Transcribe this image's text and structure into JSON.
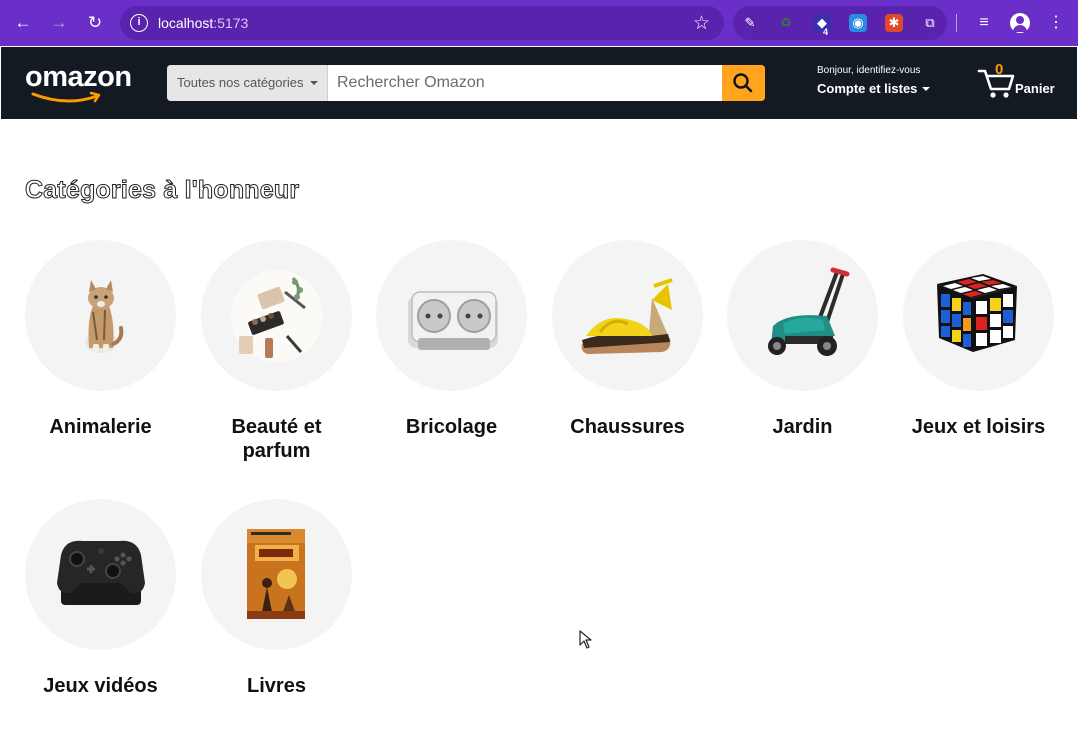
{
  "browser": {
    "url_host": "localhost",
    "url_port": ":5173",
    "extension_badge": "4"
  },
  "header": {
    "logo": "omazon",
    "search_category": "Toutes nos catégories",
    "search_placeholder": "Rechercher Omazon",
    "account_greeting": "Bonjour, identifiez-vous",
    "account_lists": "Compte et listes",
    "cart_count": "0",
    "cart_label": "Panier"
  },
  "main": {
    "section_title": "Catégories à l'honneur",
    "categories": [
      {
        "label": "Animalerie",
        "icon": "cat-photo-icon"
      },
      {
        "label": "Beauté et parfum",
        "icon": "cosmetics-photo-icon"
      },
      {
        "label": "Bricolage",
        "icon": "power-outlet-photo-icon"
      },
      {
        "label": "Chaussures",
        "icon": "sandal-photo-icon"
      },
      {
        "label": "Jardin",
        "icon": "lawn-mower-photo-icon"
      },
      {
        "label": "Jeux et loisirs",
        "icon": "rubiks-cube-photo-icon"
      },
      {
        "label": "Jeux vidéos",
        "icon": "gamepad-photo-icon"
      },
      {
        "label": "Livres",
        "icon": "book-cover-photo-icon"
      }
    ]
  },
  "colors": {
    "browser_bar": "#6b2fc9",
    "header_bg": "#131a22",
    "search_button": "#ffa41c",
    "cart_count": "#ff9900"
  }
}
